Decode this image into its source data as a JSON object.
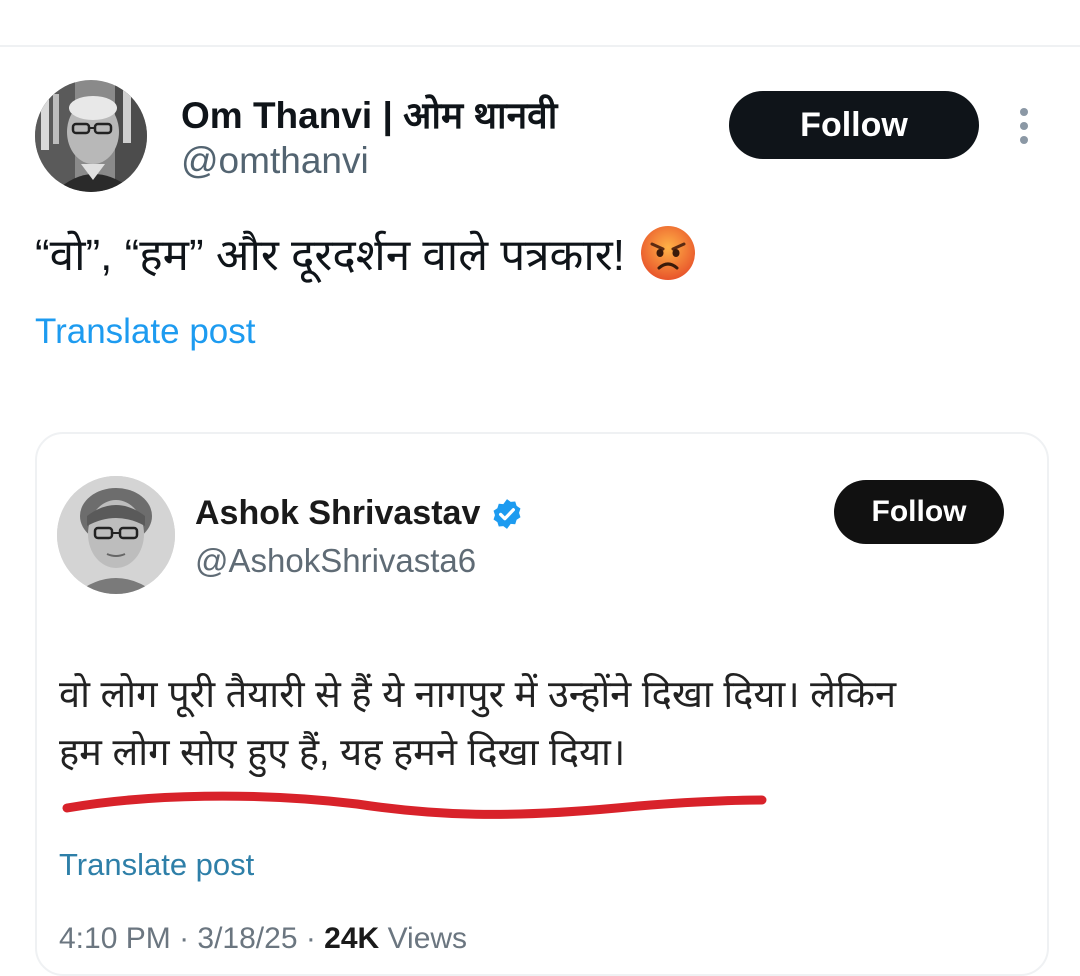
{
  "post": {
    "author_name": "Om Thanvi | ओम थानवी",
    "author_handle": "@omthanvi",
    "follow_label": "Follow",
    "text": "“वो”, “हम” और दूरदर्शन वाले पत्रकार!",
    "emoji": "angry-face-emoji",
    "translate_label": "Translate post"
  },
  "quoted_post": {
    "author_name": "Ashok Shrivastav",
    "verified": true,
    "author_handle": "@AshokShrivasta6",
    "follow_label": "Follow",
    "text_line1": "वो लोग पूरी तैयारी से हैं ये नागपुर में उन्होंने दिखा दिया। लेकिन",
    "text_line2": "हम लोग सोए हुए हैं, यह हमने दिखा दिया।",
    "translate_label": "Translate post",
    "meta": {
      "time": "4:10 PM",
      "date": "3/18/25",
      "views_count": "24K",
      "views_label": "Views"
    }
  },
  "colors": {
    "accent": "#1d9bf0",
    "follow_bg": "#0f1419",
    "underline": "#d8222a",
    "verified": "#1d9bf0"
  }
}
